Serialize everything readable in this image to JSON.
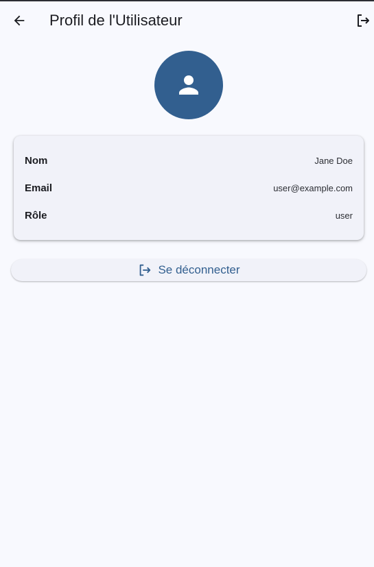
{
  "app_bar": {
    "title": "Profil de l'Utilisateur",
    "back_icon": "arrow-back-icon",
    "action_icon": "logout-icon"
  },
  "avatar": {
    "icon": "person-icon",
    "color": "#325f8f"
  },
  "profile": {
    "rows": [
      {
        "label": "Nom",
        "value": "Jane Doe"
      },
      {
        "label": "Email",
        "value": "user@example.com"
      },
      {
        "label": "Rôle",
        "value": "user"
      }
    ]
  },
  "logout_button": {
    "label": "Se déconnecter",
    "icon": "logout-icon",
    "color": "#325f8f"
  }
}
